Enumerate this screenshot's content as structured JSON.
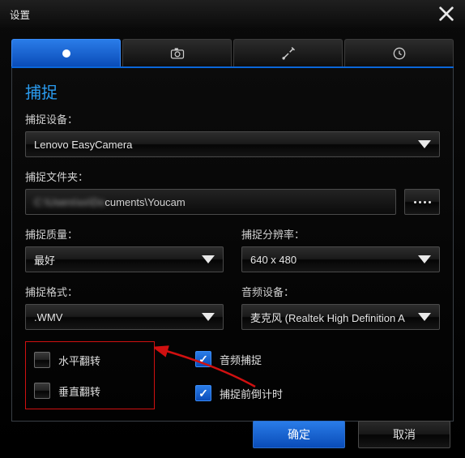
{
  "window": {
    "title": "设置"
  },
  "section": {
    "title": "捕捉"
  },
  "labels": {
    "device": "捕捉设备：",
    "folder": "捕捉文件夹：",
    "quality": "捕捉质量：",
    "resolution": "捕捉分辨率：",
    "format": "捕捉格式：",
    "audio_device": "音频设备："
  },
  "values": {
    "device": "Lenovo EasyCamera",
    "folder_visible": "cuments\\Youcam",
    "quality": "最好",
    "resolution": "640 x 480",
    "format": ".WMV",
    "audio_device": "麦克风 (Realtek High Definition A"
  },
  "checks": {
    "hflip": "水平翻转",
    "vflip": "垂直翻转",
    "audio_capture": "音频捕捉",
    "pre_countdown": "捕捉前倒计时"
  },
  "buttons": {
    "ok": "确定",
    "cancel": "取消"
  }
}
